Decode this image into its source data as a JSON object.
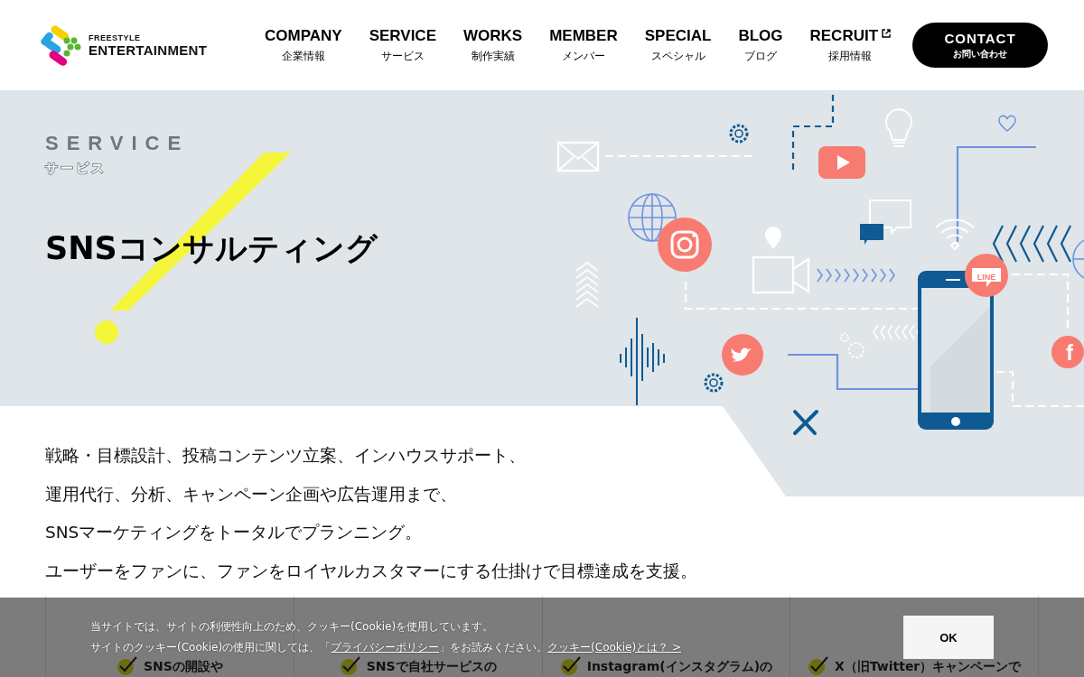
{
  "header": {
    "logo": {
      "small": "FREESTYLE",
      "large": "ENTERTAINMENT"
    },
    "nav": [
      {
        "label": "COMPANY",
        "sub": "企業情報",
        "external": false
      },
      {
        "label": "SERVICE",
        "sub": "サービス",
        "external": false
      },
      {
        "label": "WORKS",
        "sub": "制作実績",
        "external": false
      },
      {
        "label": "MEMBER",
        "sub": "メンバー",
        "external": false
      },
      {
        "label": "SPECIAL",
        "sub": "スペシャル",
        "external": false
      },
      {
        "label": "BLOG",
        "sub": "ブログ",
        "external": false
      },
      {
        "label": "RECRUIT",
        "sub": "採用情報",
        "external": true
      }
    ],
    "contact": {
      "label": "CONTACT",
      "sub": "お問い合わせ"
    }
  },
  "hero": {
    "eyebrow": "SERVICE",
    "eyebrow_sub": "サービス",
    "title": "SNSコンサルティング",
    "chat_badge": "LINE",
    "letter_badge": "f"
  },
  "intro": [
    "戦略・目標設計、投稿コンテンツ立案、インハウスサポート、",
    "運用代行、分析、キャンペーン企画や広告運用まで、",
    "SNSマーケティングをトータルでプランニング。",
    "ユーザーをファンに、ファンをロイヤルカスタマーにする仕掛けで目標達成を支援。"
  ],
  "cards": [
    {
      "title": "SNSの開設や"
    },
    {
      "title": "SNSで自社サービスの"
    },
    {
      "title": "Instagram(インスタグラム)の"
    },
    {
      "title": "X（旧Twitter）キャンペーンで"
    }
  ],
  "cookie_banner": {
    "line1": "当サイトでは、サイトの利便性向上のため、クッキー(Cookie)を使用しています。",
    "line2_before": "サイトのクッキー(Cookie)の使用に関しては、「",
    "policy_link": "プライバシーポリシー",
    "line2_after": "」をお読みください。",
    "about_link": "クッキー(Cookie)とは？ >",
    "ok": "OK"
  }
}
